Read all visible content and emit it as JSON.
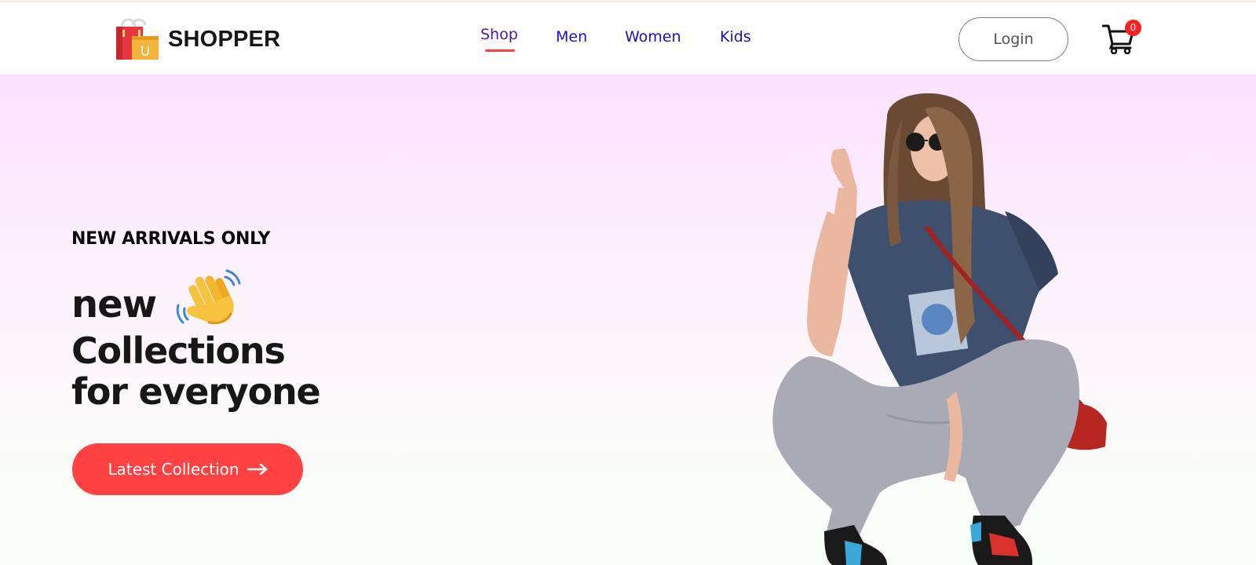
{
  "nav": {
    "brand": {
      "name": "SHOPPER",
      "logo_icon": "shopping-bags-logo-icon",
      "logo_letter": "U"
    },
    "menu": [
      {
        "label": "Shop",
        "active": true
      },
      {
        "label": "Men",
        "active": false
      },
      {
        "label": "Women",
        "active": false
      },
      {
        "label": "Kids",
        "active": false
      }
    ],
    "login_label": "Login",
    "cart": {
      "icon": "cart-icon",
      "count": "0"
    }
  },
  "hero": {
    "tagline": "NEW ARRIVALS ONLY",
    "line1": "new",
    "hand_icon": "waving-hand-icon",
    "line2": "Collections",
    "line3": "for everyone",
    "cta_label": "Latest Collection",
    "cta_icon": "arrow-right-icon",
    "image": "hero-model-image"
  },
  "colors": {
    "accent": "#ff4141",
    "nav_link": "#1a12b8",
    "hero_gradient_top": "#fbe1ff",
    "hero_gradient_bottom": "#f7fff7"
  }
}
